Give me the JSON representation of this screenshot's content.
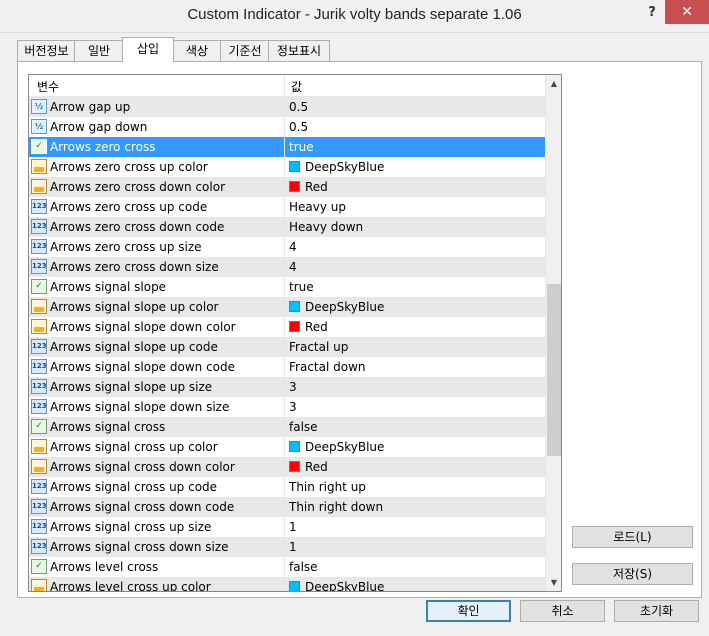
{
  "window": {
    "title": "Custom Indicator - Jurik volty bands separate 1.06",
    "help_glyph": "?",
    "close_glyph": "✕"
  },
  "tabs": [
    "버전정보",
    "일반",
    "삽입",
    "색상",
    "기준선",
    "정보표시"
  ],
  "grid": {
    "col_name": "변수",
    "col_value": "값",
    "rows": [
      {
        "icon": "half",
        "name": "Arrow gap up",
        "value": "0.5"
      },
      {
        "icon": "half",
        "name": "Arrow gap down",
        "value": "0.5"
      },
      {
        "icon": "bool",
        "name": "Arrows zero cross",
        "value": "true",
        "selected": true
      },
      {
        "icon": "color",
        "name": "Arrows zero cross up color",
        "value": "DeepSkyBlue",
        "swatch": "#00bfff"
      },
      {
        "icon": "color",
        "name": "Arrows zero cross down color",
        "value": "Red",
        "swatch": "#ff0000"
      },
      {
        "icon": "num",
        "name": "Arrows zero cross up code",
        "value": "Heavy up"
      },
      {
        "icon": "num",
        "name": "Arrows zero cross down code",
        "value": "Heavy down"
      },
      {
        "icon": "num",
        "name": "Arrows zero cross up size",
        "value": "4"
      },
      {
        "icon": "num",
        "name": "Arrows zero cross down size",
        "value": "4"
      },
      {
        "icon": "bool",
        "name": "Arrows signal slope",
        "value": "true"
      },
      {
        "icon": "color",
        "name": "Arrows signal slope up color",
        "value": "DeepSkyBlue",
        "swatch": "#00bfff"
      },
      {
        "icon": "color",
        "name": "Arrows signal slope down color",
        "value": "Red",
        "swatch": "#ff0000"
      },
      {
        "icon": "num",
        "name": "Arrows signal slope up code",
        "value": "Fractal up"
      },
      {
        "icon": "num",
        "name": "Arrows signal slope down code",
        "value": "Fractal down"
      },
      {
        "icon": "num",
        "name": "Arrows signal slope up size",
        "value": "3"
      },
      {
        "icon": "num",
        "name": "Arrows signal slope down size",
        "value": "3"
      },
      {
        "icon": "bool",
        "name": "Arrows signal cross",
        "value": "false"
      },
      {
        "icon": "color",
        "name": "Arrows signal cross up color",
        "value": "DeepSkyBlue",
        "swatch": "#00bfff"
      },
      {
        "icon": "color",
        "name": "Arrows signal cross down color",
        "value": "Red",
        "swatch": "#ff0000"
      },
      {
        "icon": "num",
        "name": "Arrows signal cross up code",
        "value": "Thin right up"
      },
      {
        "icon": "num",
        "name": "Arrows signal cross down code",
        "value": "Thin right down"
      },
      {
        "icon": "num",
        "name": "Arrows signal cross up size",
        "value": "1"
      },
      {
        "icon": "num",
        "name": "Arrows signal cross down size",
        "value": "1"
      },
      {
        "icon": "bool",
        "name": "Arrows level cross",
        "value": "false"
      },
      {
        "icon": "color",
        "name": "Arrows level cross up color",
        "value": "DeepSkyBlue",
        "swatch": "#00bfff"
      }
    ],
    "icon_glyphs": {
      "half": "½",
      "num": "123",
      "bool": "✓",
      "color": ""
    },
    "scroll_up": "▲",
    "scroll_down": "▼"
  },
  "side_buttons": {
    "load": "로드(L)",
    "save": "저장(S)"
  },
  "footer_buttons": {
    "ok": "확인",
    "cancel": "취소",
    "reset": "초기화"
  }
}
